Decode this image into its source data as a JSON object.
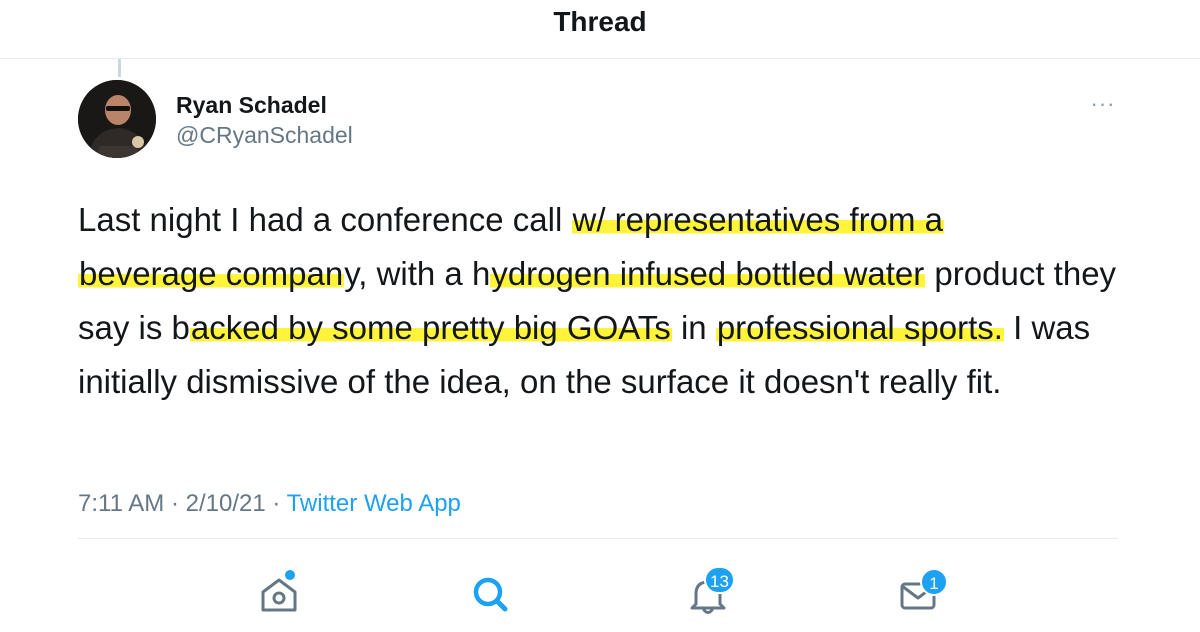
{
  "header": {
    "title": "Thread"
  },
  "tweet": {
    "author_name": "Ryan Schadel",
    "author_handle": "@CRyanSchadel",
    "more_label": "···",
    "text_segments": [
      {
        "text": "Last night I had a conference call ",
        "highlight": false
      },
      {
        "text": "w/ representatives from a",
        "highlight": true
      },
      {
        "text": " ",
        "highlight": false
      },
      {
        "text": "beverage compan",
        "highlight": true
      },
      {
        "text": "y, with a h",
        "highlight": false
      },
      {
        "text": "ydrogen infused bottled water",
        "highlight": true
      },
      {
        "text": " product they say is b",
        "highlight": false
      },
      {
        "text": "acked by some pretty big GOATs",
        "highlight": true
      },
      {
        "text": " in ",
        "highlight": false
      },
      {
        "text": "professional sports.",
        "highlight": true
      },
      {
        "text": " I was initially dismissive of the idea, on the surface it doesn't really fit.",
        "highlight": false
      }
    ],
    "time": "7:11 AM",
    "date": "2/10/21",
    "separator": " · ",
    "source_app": "Twitter Web App"
  },
  "tabbar": {
    "home_icon": "home-icon",
    "search_icon": "search-icon",
    "notifications_icon": "bell-icon",
    "notifications_count": "13",
    "messages_icon": "envelope-icon",
    "messages_count": "1"
  },
  "colors": {
    "accent": "#1da1f2",
    "highlight": "#fff43a",
    "secondary_text": "#657786"
  }
}
